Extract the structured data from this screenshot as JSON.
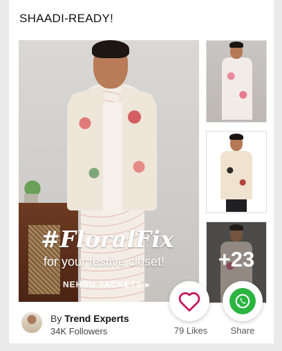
{
  "card": {
    "title": "SHAADI-READY!"
  },
  "banner": {
    "hashtag": "#FloralFix",
    "subline": "for your festive closet!",
    "cta": "NEHRU JACKETS"
  },
  "thumbnails": {
    "more_count": "+23"
  },
  "author": {
    "by_prefix": "By",
    "name": "Trend Experts",
    "followers": "34K Followers"
  },
  "actions": {
    "likes_label": "79 Likes",
    "share_label": "Share"
  },
  "icons": {
    "like": "heart-icon",
    "share": "whatsapp-icon",
    "cta_arrow": "chevron-right-icon"
  },
  "colors": {
    "heart": "#c2185b",
    "whatsapp": "#2bb540"
  }
}
